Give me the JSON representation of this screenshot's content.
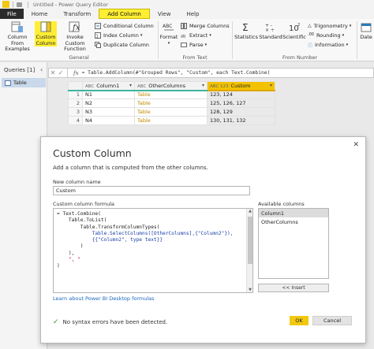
{
  "window": {
    "title": "Untitled - Power Query Editor"
  },
  "ribbon": {
    "tabs": [
      "File",
      "Home",
      "Transform",
      "Add Column",
      "View",
      "Help"
    ],
    "active_tab": "Add Column",
    "groups": {
      "general": {
        "label": "General",
        "column_from_examples": "Column From Examples",
        "custom_column": "Custom Column",
        "invoke_custom_function": "Invoke Custom Function",
        "conditional_column": "Conditional Column",
        "index_column": "Index Column",
        "duplicate_column": "Duplicate Column"
      },
      "from_text": {
        "label": "From Text",
        "format": "Format",
        "merge_columns": "Merge Columns",
        "extract": "Extract",
        "parse": "Parse"
      },
      "from_number": {
        "label": "From Number",
        "statistics": "Statistics",
        "standard": "Standard",
        "scientific": "Scientific",
        "trigonometry": "Trigonometry",
        "rounding": "Rounding",
        "information": "Information",
        "date": "Date"
      }
    }
  },
  "queries": {
    "header": "Queries [1]",
    "items": [
      "Table"
    ]
  },
  "formula_bar": {
    "text": "= Table.AddColumn(#\"Grouped Rows\", \"Custom\", each Text.Combine("
  },
  "grid": {
    "columns": [
      "Column1",
      "OtherColumns",
      "Custom"
    ],
    "column_type_icons": [
      "ABC",
      "ABC",
      "ABC 123"
    ],
    "rows": [
      {
        "n": "1",
        "c1": "N1",
        "c2": "Table",
        "c3": "123, 124"
      },
      {
        "n": "2",
        "c1": "N2",
        "c2": "Table",
        "c3": "125, 126, 127"
      },
      {
        "n": "3",
        "c1": "N3",
        "c2": "Table",
        "c3": "128, 129"
      },
      {
        "n": "4",
        "c1": "N4",
        "c2": "Table",
        "c3": "130, 131, 132"
      }
    ]
  },
  "dialog": {
    "title": "Custom Column",
    "description": "Add a column that is computed from the other columns.",
    "name_label": "New column name",
    "name_value": "Custom",
    "formula_label": "Custom column formula",
    "formula_lines": [
      "= Text.Combine(",
      "    Table.ToList(",
      "        Table.TransformColumnTypes(",
      "            Table.SelectColumns([OtherColumns],{\"Column2\"}),",
      "            {{\"Column2\", type text}}",
      "        )",
      "    ),",
      "    \", \"",
      ")"
    ],
    "available_label": "Available columns",
    "available_columns": [
      "Column1",
      "OtherColumns"
    ],
    "insert_label": "<< Insert",
    "learn_link": "Learn about Power BI Desktop formulas",
    "status": "No syntax errors have been detected.",
    "ok_label": "OK",
    "cancel_label": "Cancel"
  },
  "colors": {
    "accent_yellow": "#f2c811",
    "grid_header_teal": "#3fb3a0",
    "link_blue": "#1a66c0",
    "success_green": "#2a9d3a"
  }
}
